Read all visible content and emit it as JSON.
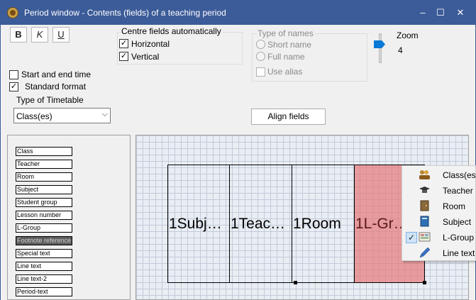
{
  "window": {
    "title": "Period window - Contents (fields) of a teaching period",
    "minimize": "–",
    "maximize": "☐",
    "close": "✕"
  },
  "format_buttons": {
    "bold": "B",
    "italic": "K",
    "underline": "U"
  },
  "centre_fields": {
    "legend": "Centre fields automatically",
    "horizontal": {
      "label": "Horizontal",
      "checked": true
    },
    "vertical": {
      "label": "Vertical",
      "checked": true
    }
  },
  "type_of_names": {
    "legend": "Type of names",
    "short_name": "Short name",
    "full_name": "Full name",
    "use_alias": "Use alias"
  },
  "zoom": {
    "label": "Zoom",
    "value": "4"
  },
  "options": {
    "start_end_time": {
      "label": "Start and end time",
      "checked": false
    },
    "standard_format": {
      "label": "Standard format",
      "checked": true
    }
  },
  "timetable_type": {
    "label": "Type of Timetable",
    "selected": "Class(es)"
  },
  "align_fields_button": "Align fields",
  "field_list": [
    "Class",
    "Teacher",
    "Room",
    "Subject",
    "Student group",
    "Lesson number",
    "L-Group",
    "Footnote reference",
    "Special text",
    "Line text",
    "Line text-2",
    "Period-text"
  ],
  "field_list_selected": "Footnote reference",
  "period_cells": [
    "1Subj…",
    "1Teac…",
    "1Room",
    "1L-Gr…"
  ],
  "context_menu": [
    {
      "label": "Class(es)",
      "icon": "class-icon",
      "checked": false
    },
    {
      "label": "Teacher",
      "icon": "teacher-icon",
      "checked": false
    },
    {
      "label": "Room",
      "icon": "room-icon",
      "checked": false
    },
    {
      "label": "Subject",
      "icon": "subject-icon",
      "checked": false
    },
    {
      "label": "L-Group",
      "icon": "lgroup-icon",
      "checked": true
    },
    {
      "label": "Line text",
      "icon": "pen-icon",
      "checked": false
    }
  ],
  "colors": {
    "titlebar": "#3c5b99",
    "highlight_cell": "#e67878",
    "slider": "#0a78d7"
  }
}
